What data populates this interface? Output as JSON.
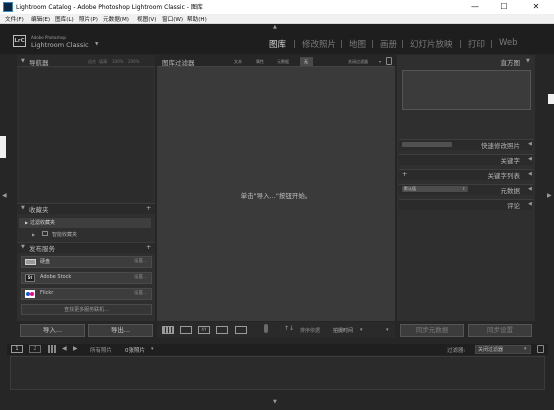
{
  "window": {
    "title": "Lightroom Catalog - Adobe Photoshop Lightroom Classic - 图库",
    "minimize": "—",
    "maximize": "☐",
    "close": "✕"
  },
  "menu": [
    "文件(F)",
    "编辑(E)",
    "图库(L)",
    "照片(P)",
    "元数据(M)",
    "视图(V)",
    "窗口(W)",
    "帮助(H)"
  ],
  "identity": {
    "logo": "LrC",
    "brand_top": "Adobe Photoshop",
    "brand_name": "Lightroom Classic",
    "brand_chevron": "▼"
  },
  "modules": [
    "图库",
    "修改照片",
    "地图",
    "画册",
    "幻灯片放映",
    "打印",
    "Web"
  ],
  "left_panel": {
    "navigator": {
      "title": "导航器",
      "zoom_options": [
        "适合",
        "填满",
        "100%",
        "200%"
      ]
    },
    "collections": {
      "title": "收藏夹",
      "add": "+",
      "items": [
        {
          "label": "过滤收藏夹"
        },
        {
          "label": "智能收藏夹"
        }
      ]
    },
    "publish": {
      "title": "发布服务",
      "add": "+",
      "services": [
        {
          "label": "硬盘",
          "action": "设置..."
        },
        {
          "label": "Adobe Stock",
          "action": "设置..."
        },
        {
          "label": "Flickr",
          "action": "设置..."
        }
      ],
      "find_more": "查找更多服务联机..."
    },
    "import_button": "导入...",
    "export_button": "导出..."
  },
  "center": {
    "filter_bar": {
      "title": "图库过滤器",
      "tabs": [
        "文本",
        "属性",
        "元数据",
        "无"
      ],
      "preset": "关闭过滤器"
    },
    "message": "单击\"导入...\"按钮开始。",
    "toolbar": {
      "sort_label": "排序依据",
      "sort_value": "拍摄时间"
    }
  },
  "right_panel": {
    "histogram": {
      "title": "直方图"
    },
    "quick_develop": {
      "title": "快速修改照片"
    },
    "keywording": {
      "title": "关键字"
    },
    "keyword_list": {
      "title": "关键字列表",
      "add": "+"
    },
    "metadata": {
      "title": "元数据",
      "preset": "默认值"
    },
    "comments": {
      "title": "评论"
    },
    "sync_metadata_button": "同步元数据",
    "sync_settings_button": "同步设置"
  },
  "filmstrip_bar": {
    "page_1": "1",
    "page_2": "2",
    "source": "所有照片",
    "count": "0张照片",
    "filter_label": "过滤器:",
    "filter_value": "关闭过滤器"
  },
  "colors": {
    "window_bg": "#262626",
    "panel_bg": "#2f2f2f",
    "center_bg": "#3a3a3a",
    "active_module": "#cfcfcf",
    "inactive_module": "#7b7b7b",
    "adobe_stock": "#1c1c1c",
    "flickr_blue": "#0063dc",
    "flickr_pink": "#ff0084"
  }
}
